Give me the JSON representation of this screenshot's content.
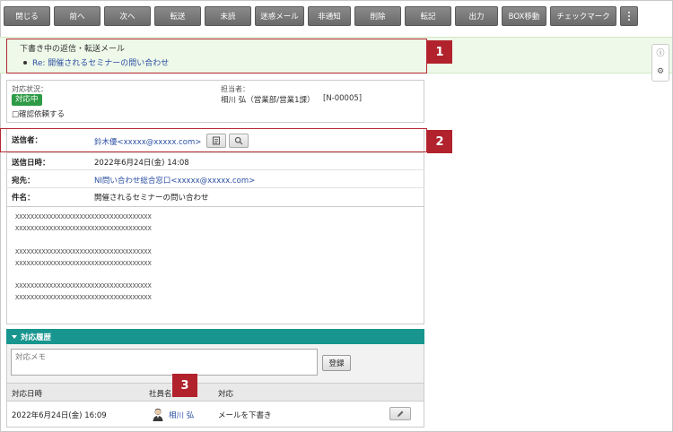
{
  "toolbar": {
    "buttons": [
      "閉じる",
      "前へ",
      "次へ",
      "転送",
      "未読",
      "迷惑メール",
      "非通知",
      "削除",
      "転記",
      "出力",
      "BOX移動",
      "チェックマーク"
    ]
  },
  "draft": {
    "title": "下書き中の返信・転送メール",
    "link": "Re: 開催されるセミナーの問い合わせ"
  },
  "badges": [
    "1",
    "2",
    "3"
  ],
  "status": {
    "label": "対応状況：",
    "value": "対応中",
    "confirm": "□確認依頼する",
    "assignee_label": "担当者：",
    "assignee": "相川 弘（営業部/営業1課）",
    "ticket": "[N-00005]"
  },
  "mail": {
    "sender_label": "送信者：",
    "sender": "鈴木優<xxxxx@xxxxx.com>",
    "sent_label": "送信日時：",
    "sent": "2022年6月24日(金) 14:08",
    "to_label": "宛先：",
    "to": "NI問い合わせ総合窓口<xxxxx@xxxxx.com>",
    "subject_label": "件名：",
    "subject": "開催されるセミナーの問い合わせ",
    "body_lines": [
      "XXXXXXXXXXXXXXXXXXXXXXXXXXXXXXXXXXXX",
      "XXXXXXXXXXXXXXXXXXXXXXXXXXXXXXXXXXXX",
      "XXXXXXXXXXXXXXXXXXXXXXXXXXXXXXXXXXXX",
      "XXXXXXXXXXXXXXXXXXXXXXXXXXXXXXXXXXXX",
      "XXXXXXXXXXXXXXXXXXXXXXXXXXXXXXXXXXXX",
      "XXXXXXXXXXXXXXXXXXXXXXXXXXXXXXXXXXXX"
    ]
  },
  "history": {
    "title": "対応履歴",
    "memo_placeholder": "対応メモ",
    "register": "登録",
    "col_date": "対応日時",
    "col_staff": "社員名",
    "col_action": "対応",
    "rows": [
      {
        "date": "2022年6月24日(金) 16:09",
        "staff": "相川 弘",
        "action": "メールを下書き"
      }
    ]
  },
  "colors": {
    "accent_red": "#b1222d",
    "status_green": "#2e9b46",
    "history_teal": "#17958e",
    "link_blue": "#2c4fa3"
  }
}
